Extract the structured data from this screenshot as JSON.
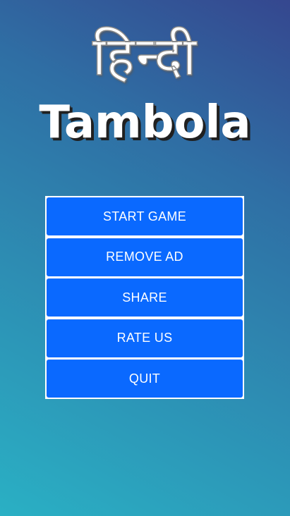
{
  "logo": {
    "hindi_text": "हिन्दी",
    "title": "Tambola"
  },
  "menu": {
    "items": [
      {
        "label": "START GAME"
      },
      {
        "label": "REMOVE AD"
      },
      {
        "label": "SHARE"
      },
      {
        "label": "RATE US"
      },
      {
        "label": "QUIT"
      }
    ]
  },
  "colors": {
    "button": "#0a69ff",
    "menu_frame": "#ffffff",
    "background_top": "#35478f",
    "background_bottom": "#2ab0c4"
  }
}
